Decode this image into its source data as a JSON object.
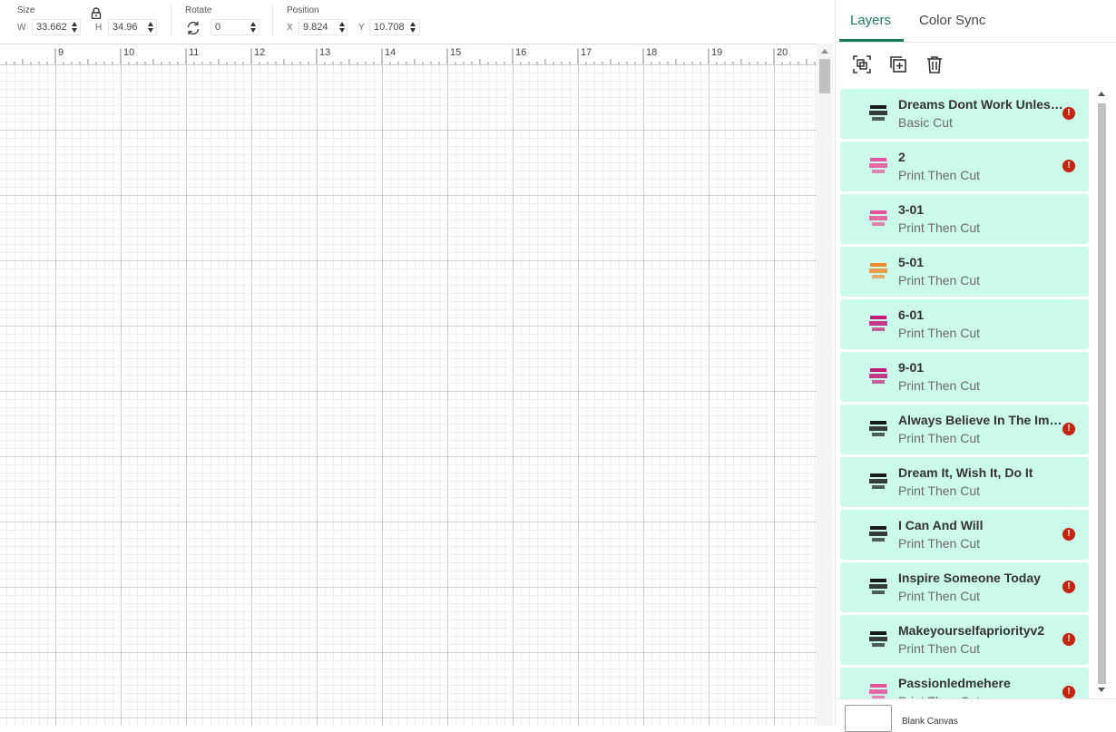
{
  "toolbar": {
    "size": {
      "label": "Size",
      "w_label": "W",
      "w_value": "33.662",
      "h_label": "H",
      "h_value": "34.96",
      "lock_icon": "lock-icon"
    },
    "rotate": {
      "label": "Rotate",
      "value": "0",
      "icon": "rotate-icon"
    },
    "position": {
      "label": "Position",
      "x_label": "X",
      "x_value": "9.824",
      "y_label": "Y",
      "y_value": "10.708"
    }
  },
  "ruler": {
    "labels": [
      "9",
      "10",
      "11",
      "12",
      "13",
      "14",
      "15",
      "16",
      "17",
      "18",
      "19",
      "20"
    ]
  },
  "panel": {
    "tabs": [
      {
        "label": "Layers",
        "active": true
      },
      {
        "label": "Color Sync",
        "active": false
      }
    ],
    "tools": [
      "group-icon",
      "duplicate-icon",
      "trash-icon"
    ],
    "layers": [
      {
        "name": "Dreams Dont Work Unless You Do",
        "type": "Basic Cut",
        "warning": true,
        "thumb": "dark"
      },
      {
        "name": "2",
        "type": "Print Then Cut",
        "warning": true,
        "thumb": "pink"
      },
      {
        "name": "3-01",
        "type": "Print Then Cut",
        "warning": false,
        "thumb": "pink"
      },
      {
        "name": "5-01",
        "type": "Print Then Cut",
        "warning": false,
        "thumb": "orange"
      },
      {
        "name": "6-01",
        "type": "Print Then Cut",
        "warning": false,
        "thumb": "magenta"
      },
      {
        "name": "9-01",
        "type": "Print Then Cut",
        "warning": false,
        "thumb": "magenta"
      },
      {
        "name": "Always Believe In The Impossible",
        "type": "Print Then Cut",
        "warning": true,
        "thumb": "dark"
      },
      {
        "name": "Dream It, Wish It, Do It",
        "type": "Print Then Cut",
        "warning": false,
        "thumb": "dark"
      },
      {
        "name": "I Can And Will",
        "type": "Print Then Cut",
        "warning": true,
        "thumb": "dark"
      },
      {
        "name": "Inspire Someone Today",
        "type": "Print Then Cut",
        "warning": true,
        "thumb": "dark"
      },
      {
        "name": "Makeyourselfapriorityv2",
        "type": "Print Then Cut",
        "warning": true,
        "thumb": "dark"
      },
      {
        "name": "Passionledmehere",
        "type": "Print Then Cut",
        "warning": true,
        "thumb": "pink"
      }
    ],
    "warning_glyph": "!",
    "canvas_label": "Blank Canvas"
  },
  "colors": {
    "accent": "#1b7a58",
    "layer_bg": "#cbfaea",
    "warning": "#c5240f"
  }
}
